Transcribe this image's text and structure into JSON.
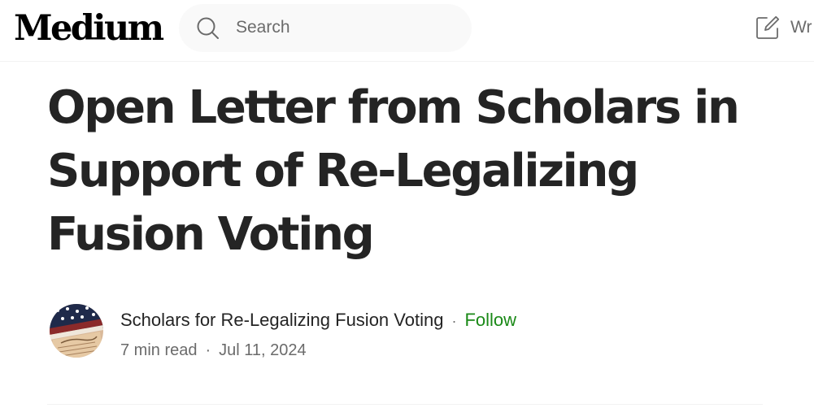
{
  "header": {
    "logo": "Medium",
    "search": {
      "placeholder": "Search",
      "value": ""
    },
    "write_label": "Wr"
  },
  "article": {
    "title": "Open Letter from Scholars in Support of Re-Legalizing Fusion Voting",
    "author": "Scholars for Re-Legalizing Fusion Voting",
    "separator": "·",
    "follow_label": "Follow",
    "read_time": "7 min read",
    "date": "Jul 11, 2024"
  },
  "colors": {
    "follow": "#1a8917",
    "text": "#242424",
    "muted": "#6b6b6b"
  },
  "icons": {
    "search": "search-icon",
    "write": "write-icon"
  }
}
